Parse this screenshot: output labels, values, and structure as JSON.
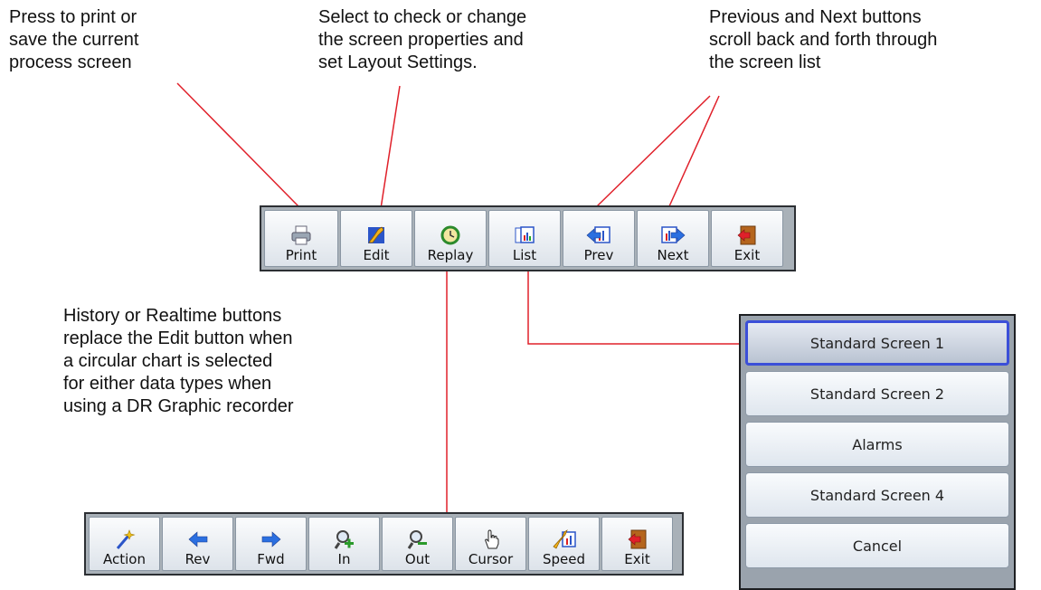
{
  "callouts": {
    "print": "Press to print or\nsave the current\nprocess screen",
    "edit": "Select to check or change\nthe screen properties and\nset Layout Settings.",
    "prevnext": "Previous and Next buttons\nscroll back and forth through\nthe screen list",
    "history": "History or Realtime buttons\nreplace the Edit button when\na circular chart is selected\nfor either data types when\nusing a DR Graphic recorder"
  },
  "main_toolbar": [
    {
      "label": "Print",
      "icon": "printer-icon"
    },
    {
      "label": "Edit",
      "icon": "edit-icon"
    },
    {
      "label": "Replay",
      "icon": "replay-icon"
    },
    {
      "label": "List",
      "icon": "list-icon"
    },
    {
      "label": "Prev",
      "icon": "prev-icon"
    },
    {
      "label": "Next",
      "icon": "next-icon"
    },
    {
      "label": "Exit",
      "icon": "exit-icon"
    }
  ],
  "replay_toolbar": [
    {
      "label": "Action",
      "icon": "wand-icon"
    },
    {
      "label": "Rev",
      "icon": "arrow-left-icon"
    },
    {
      "label": "Fwd",
      "icon": "arrow-right-icon"
    },
    {
      "label": "In",
      "icon": "zoom-in-icon"
    },
    {
      "label": "Out",
      "icon": "zoom-out-icon"
    },
    {
      "label": "Cursor",
      "icon": "hand-cursor-icon"
    },
    {
      "label": "Speed",
      "icon": "speed-icon"
    },
    {
      "label": "Exit",
      "icon": "exit-icon"
    }
  ],
  "screen_list": [
    {
      "label": "Standard Screen 1",
      "selected": true
    },
    {
      "label": "Standard Screen 2",
      "selected": false
    },
    {
      "label": "Alarms",
      "selected": false
    },
    {
      "label": "Standard Screen 4",
      "selected": false
    },
    {
      "label": "Cancel",
      "selected": false
    }
  ],
  "colors": {
    "leader_line": "#e0202a",
    "menu_highlight": "#3b4fd8"
  }
}
